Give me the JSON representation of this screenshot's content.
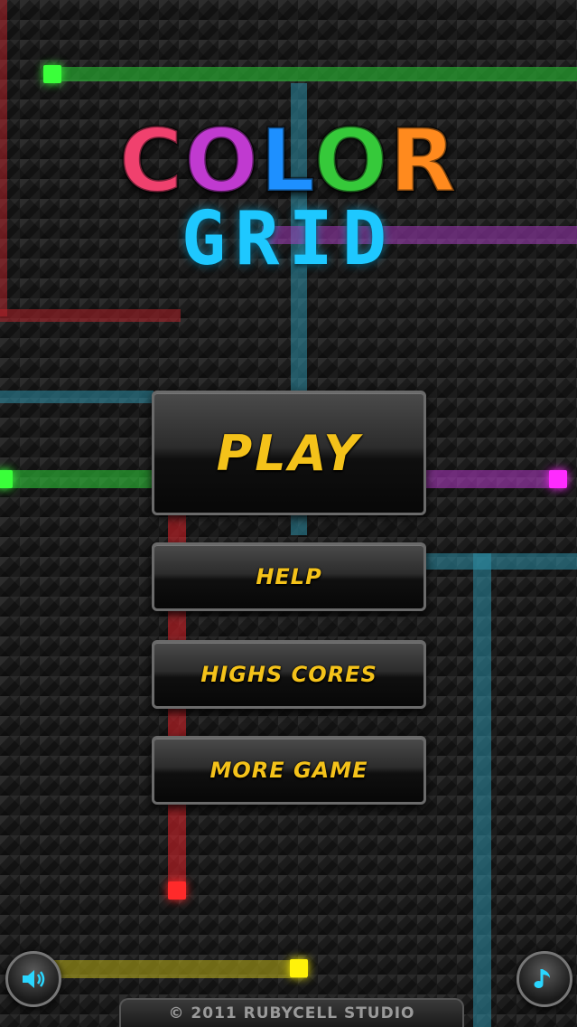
{
  "title": {
    "word1_letters": [
      "C",
      "O",
      "L",
      "O",
      "R"
    ],
    "word1_colors": [
      "#f0416e",
      "#c03ad0",
      "#1e90ff",
      "#36c93a",
      "#ff8a1e"
    ],
    "word2": "GRID",
    "word2_color": "#1ec8ff"
  },
  "menu": {
    "play_label": "PLAY",
    "help_label": "HELP",
    "highscores_label": "HIGHS CORES",
    "more_game_label": "MORE GAME"
  },
  "controls": {
    "sound_icon": "speaker-icon",
    "music_icon": "music-note-icon"
  },
  "footer": {
    "copyright": "© 2011 RUBYCELL STUDIO"
  },
  "grid_colors": {
    "green": "#2fd13a",
    "purple": "#b43ac9",
    "magenta": "#ff2bff",
    "red": "#e0232a",
    "teal": "#2e8fa8",
    "yellow": "#f4e60a",
    "button_text": "#f4c21a"
  }
}
